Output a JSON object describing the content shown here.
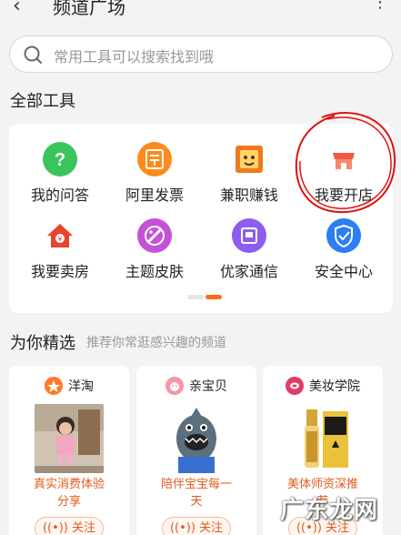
{
  "header": {
    "title": "频道广场",
    "back_icon": "chevron-left-icon",
    "more_icon": "more-vertical-icon"
  },
  "search": {
    "placeholder": "常用工具可以搜索找到哦"
  },
  "tools": {
    "title": "全部工具",
    "items": [
      {
        "label": "我的问答",
        "icon": "question-icon",
        "color": "#3cc45c"
      },
      {
        "label": "阿里发票",
        "icon": "invoice-icon",
        "color": "#ff8a1c"
      },
      {
        "label": "兼职赚钱",
        "icon": "part-time-icon",
        "color": "#f07a1a"
      },
      {
        "label": "我要开店",
        "icon": "shop-icon",
        "color": "#f25a43"
      },
      {
        "label": "我要卖房",
        "icon": "house-icon",
        "color": "#e8452c"
      },
      {
        "label": "主题皮肤",
        "icon": "theme-icon",
        "color": "#c452d6"
      },
      {
        "label": "优家通信",
        "icon": "phone-icon",
        "color": "#8d5df0"
      },
      {
        "label": "安全中心",
        "icon": "shield-icon",
        "color": "#2c7ff0"
      }
    ]
  },
  "recommend": {
    "title": "为你精选",
    "subtitle": "推荐你常逛感兴趣的频道",
    "cards": [
      {
        "name": "洋淘",
        "desc_line1": "真实消费体验",
        "desc_line2": "分享",
        "follow": "关注"
      },
      {
        "name": "亲宝贝",
        "desc_line1": "陪伴宝宝每一",
        "desc_line2": "天",
        "follow": "关注"
      },
      {
        "name": "美妆学院",
        "desc_line1": "美体师资深推",
        "desc_line2": "荐",
        "follow": "关注"
      }
    ]
  },
  "watermark": "广东龙网",
  "colors": {
    "accent": "#ff6a1a",
    "annotation": "#e01010"
  }
}
